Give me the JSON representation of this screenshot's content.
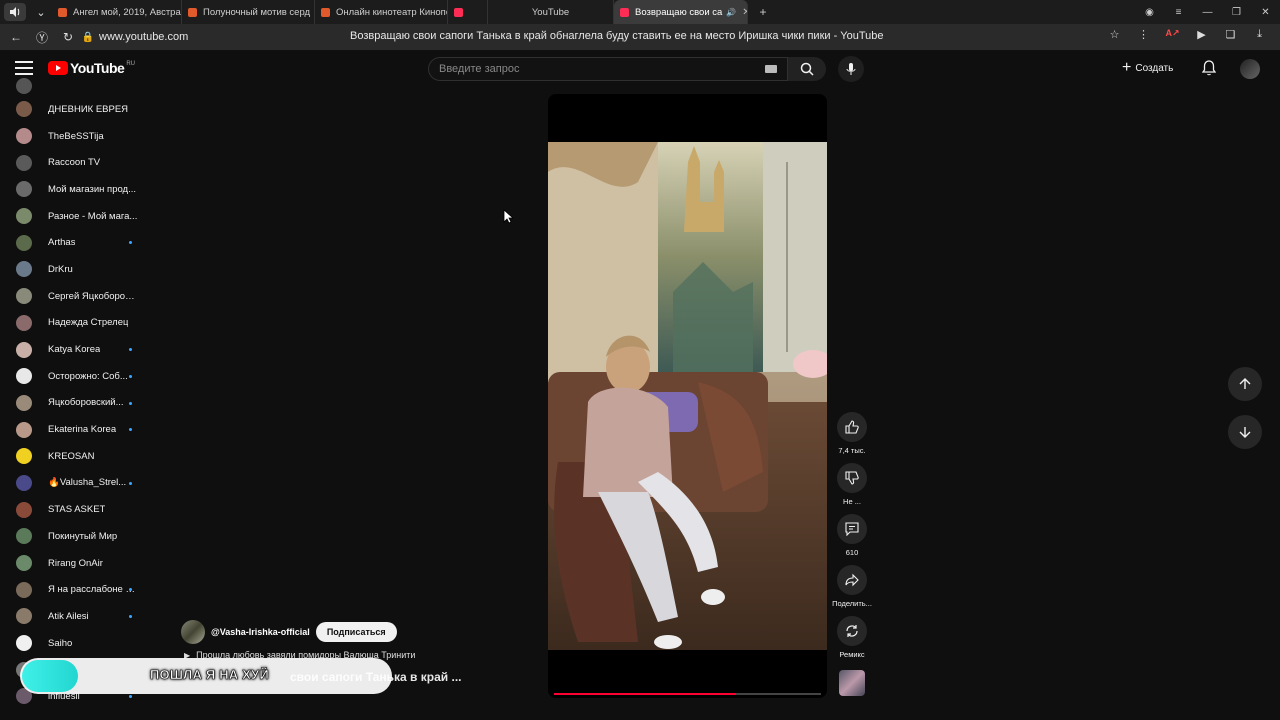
{
  "browser": {
    "tabs": [
      {
        "label": "Ангел мой, 2019, Австрал",
        "fav_color": "#e05a2b"
      },
      {
        "label": "Полуночный мотив серд",
        "fav_color": "#e05a2b"
      },
      {
        "label": "Онлайн кинотеатр Кинопо",
        "fav_color": "#e05a2b"
      },
      {
        "label": "",
        "fav_color": "#ff2d55"
      },
      {
        "label": "YouTube",
        "fav_color": "#ff2d55"
      },
      {
        "label": "Возвращаю свои са",
        "fav_color": "#ff2d55",
        "active": true
      }
    ],
    "url": "www.youtube.com",
    "page_title": "Возвращаю свои сапоги Танька в край обнаглела буду ставить ее на место Иришка чики пики - YouTube"
  },
  "header": {
    "logo_text": "YouTube",
    "region": "RU",
    "search_placeholder": "Введите запрос",
    "create_label": "Создать"
  },
  "sidebar": {
    "items": [
      {
        "label": "ДНЕВНИК ЕВРЕЯ",
        "color": "#7a5a48",
        "dot": false
      },
      {
        "label": "TheBeSSTija",
        "color": "#b48a8a",
        "dot": false
      },
      {
        "label": "Raccoon TV",
        "color": "#5a5a5a",
        "dot": false
      },
      {
        "label": "Мой магазин прод...",
        "color": "#6a6a6a",
        "dot": false
      },
      {
        "label": "Разное - Мой мага...",
        "color": "#7a8a6a",
        "dot": false
      },
      {
        "label": "Arthas",
        "color": "#5a6a4a",
        "dot": true
      },
      {
        "label": "DrKru",
        "color": "#6a7a8a",
        "dot": false
      },
      {
        "label": "Сергей Яцкоборов...",
        "color": "#8a8a7a",
        "dot": false
      },
      {
        "label": "Надежда Стрелец",
        "color": "#8a6a6a",
        "dot": false
      },
      {
        "label": "Katya Korea",
        "color": "#c8b0a8",
        "dot": true
      },
      {
        "label": "Осторожно: Соб...",
        "color": "#e8e8e8",
        "dot": true
      },
      {
        "label": "Яцкоборовский...",
        "color": "#9a8a7a",
        "dot": true
      },
      {
        "label": "Ekaterina Korea",
        "color": "#b89888",
        "dot": true
      },
      {
        "label": "KREOSAN",
        "color": "#f0d020",
        "dot": false
      },
      {
        "label": "🔥Valusha_Strel...",
        "color": "#4a4a8a",
        "dot": true
      },
      {
        "label": "STAS ASKET",
        "color": "#8a4a3a",
        "dot": false
      },
      {
        "label": "Покинутый Мир",
        "color": "#5a7a5a",
        "dot": false
      },
      {
        "label": "Rirang OnAir",
        "color": "#6a8a6a",
        "dot": false
      },
      {
        "label": "Я на расслабоне З...",
        "color": "#7a6a5a",
        "dot": true
      },
      {
        "label": "Atik Ailesi",
        "color": "#8a7a6a",
        "dot": true
      },
      {
        "label": "Saiho",
        "color": "#f0f0f0",
        "dot": false
      },
      {
        "label": "",
        "color": "#777777",
        "dot": false
      },
      {
        "label": "influesii",
        "color": "#6a5a6a",
        "dot": true
      }
    ]
  },
  "video": {
    "progress_fraction": 0.68
  },
  "actions": {
    "likes": "7,4 тыс.",
    "dislike": "Не ...",
    "comments": "610",
    "share": "Поделить...",
    "remix": "Ремикс"
  },
  "channel": {
    "handle": "@Vasha-Irishka-official",
    "subscribe": "Подписаться",
    "song": "Прошла любовь завяли помидоры Валюша Тринити",
    "title_fragment": "свои  сапоги Танька в край ..."
  },
  "caption": {
    "text": "ПОШЛА Я НА ХУЙ"
  }
}
